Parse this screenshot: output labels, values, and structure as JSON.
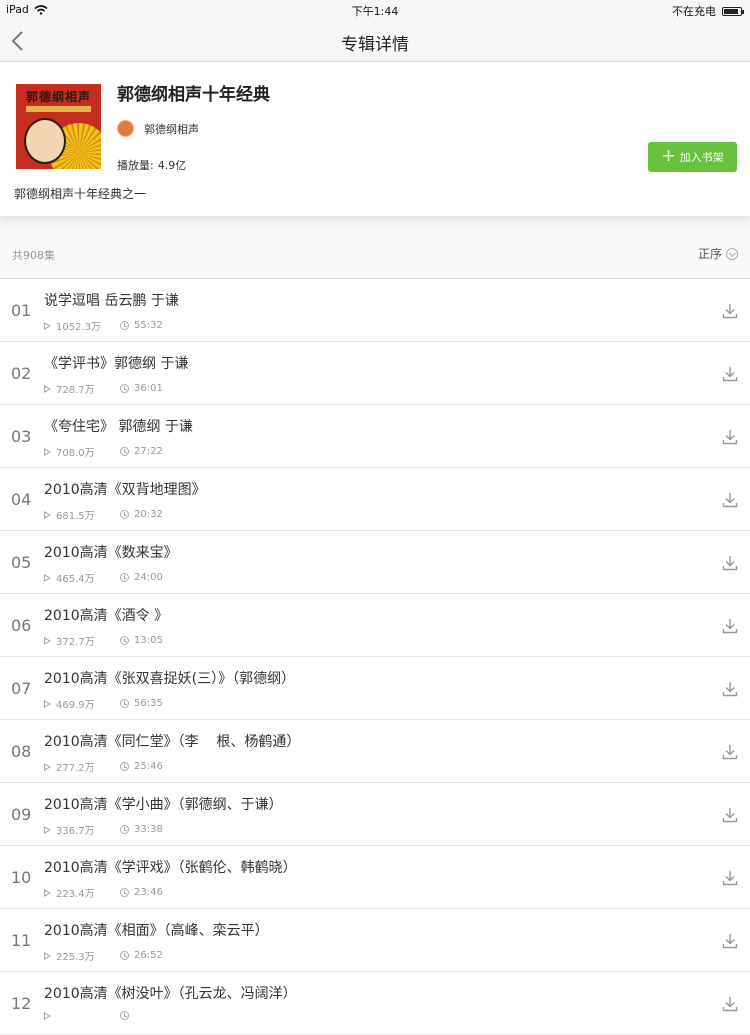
{
  "status": {
    "device": "iPad",
    "time": "下午1:44",
    "battery_text": "不在充电"
  },
  "nav": {
    "title": "专辑详情"
  },
  "album": {
    "cover_text": "郭德纲相声",
    "title": "郭德纲相声十年经典",
    "author": "郭德纲相声",
    "plays_label": "播放量:",
    "plays_value": "4.9亿",
    "description": "郭德纲相声十年经典之一",
    "add_button": "加入书架",
    "accent": "#69c23e"
  },
  "list": {
    "count": "共908集",
    "sort": "正序",
    "episodes": [
      {
        "num": "01",
        "title": "说学逗唱 岳云鹏 于谦",
        "plays": "1052.3万",
        "duration": "55:32"
      },
      {
        "num": "02",
        "title": "《学评书》郭德纲 于谦",
        "plays": "728.7万",
        "duration": "36:01"
      },
      {
        "num": "03",
        "title": "《夸住宅》 郭德纲 于谦",
        "plays": "708.0万",
        "duration": "27:22"
      },
      {
        "num": "04",
        "title": "2010高清《双背地理图》",
        "plays": "681.5万",
        "duration": "20:32"
      },
      {
        "num": "05",
        "title": "2010高清《数来宝》",
        "plays": "465.4万",
        "duration": "24:00"
      },
      {
        "num": "06",
        "title": "2010高清《酒令 》",
        "plays": "372.7万",
        "duration": "13:05"
      },
      {
        "num": "07",
        "title": "2010高清《张双喜捉妖(三）》（郭德纲）",
        "plays": "469.9万",
        "duration": "56:35"
      },
      {
        "num": "08",
        "title": "2010高清《同仁堂》（李    根、杨鹤通）",
        "plays": "277.2万",
        "duration": "25:46"
      },
      {
        "num": "09",
        "title": "2010高清《学小曲》（郭德纲、于谦）",
        "plays": "336.7万",
        "duration": "33:38"
      },
      {
        "num": "10",
        "title": "2010高清《学评戏》（张鹤伦、韩鹤晓）",
        "plays": "223.4万",
        "duration": "23:46"
      },
      {
        "num": "11",
        "title": "2010高清《相面》（高峰、栾云平）",
        "plays": "225.3万",
        "duration": "26:52"
      },
      {
        "num": "12",
        "title": "2010高清《树没叶》（孔云龙、冯阔洋）",
        "plays": "",
        "duration": ""
      }
    ]
  }
}
